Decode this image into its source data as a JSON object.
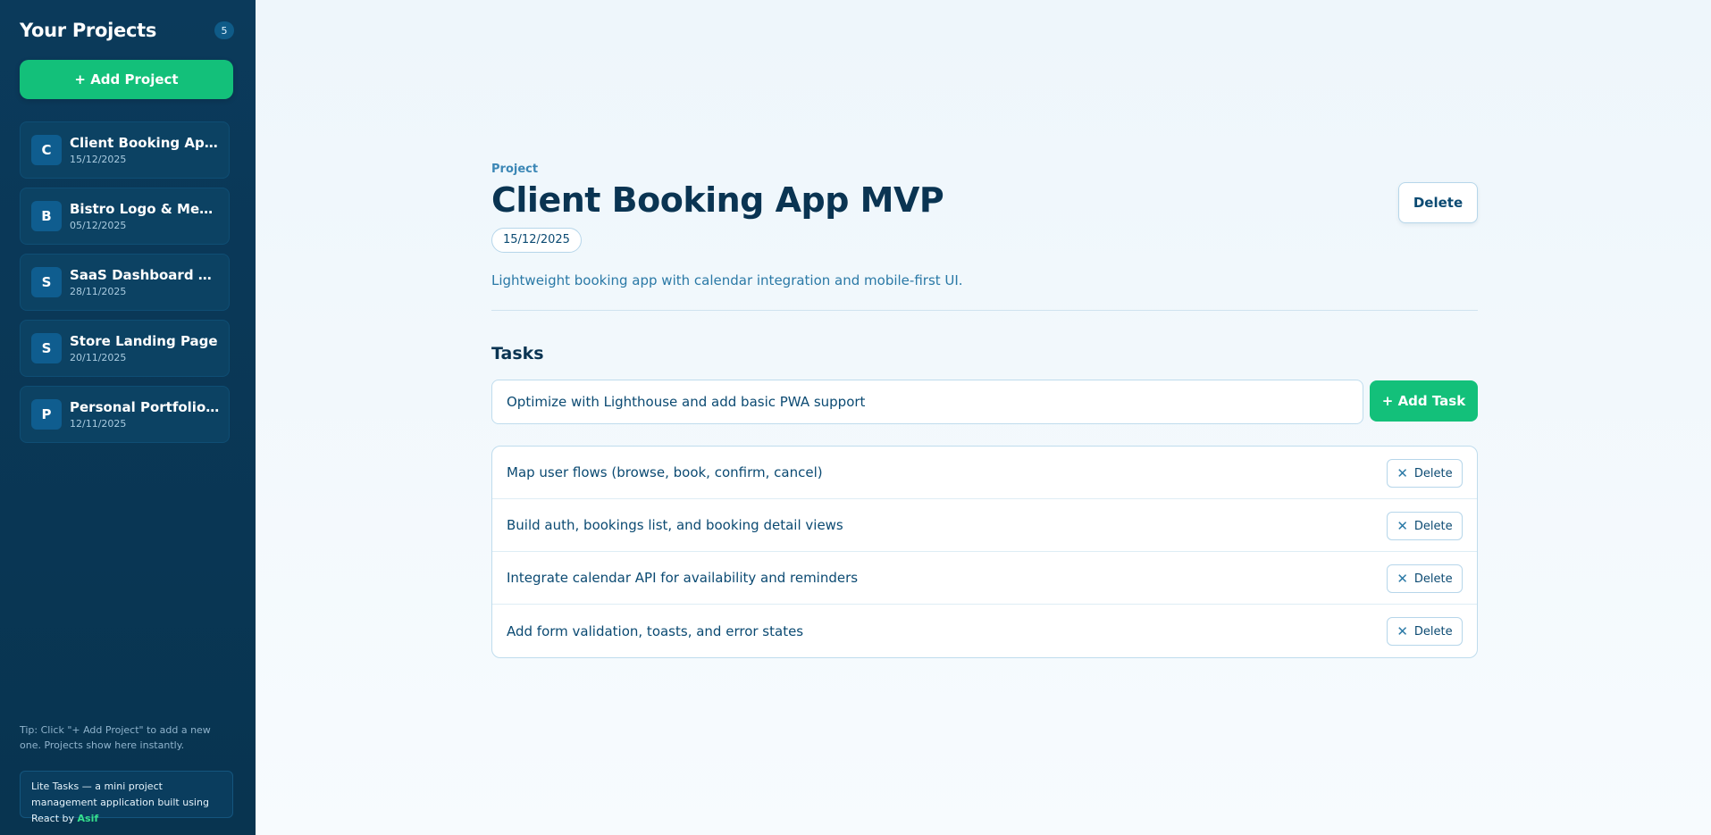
{
  "sidebar": {
    "title": "Your Projects",
    "count": "5",
    "add_project_label": "+ Add Project",
    "projects": [
      {
        "initial": "C",
        "name": "Client Booking App MVP",
        "date": "15/12/2025"
      },
      {
        "initial": "B",
        "name": "Bistro Logo & Menu Design",
        "date": "05/12/2025"
      },
      {
        "initial": "S",
        "name": "SaaS Dashboard UI Kit",
        "date": "28/11/2025"
      },
      {
        "initial": "S",
        "name": "Store Landing Page",
        "date": "20/11/2025"
      },
      {
        "initial": "P",
        "name": "Personal Portfolio Redesign",
        "date": "12/11/2025"
      }
    ],
    "tip": "Tip: Click \"+ Add Project\" to add a new one. Projects show here instantly.",
    "footer_text": "Lite Tasks — a mini project management application built using React by",
    "footer_author": "Asif"
  },
  "project": {
    "eyebrow": "Project",
    "title": "Client Booking App MVP",
    "delete_label": "Delete",
    "date": "15/12/2025",
    "description": "Lightweight booking app with calendar integration and mobile-first UI."
  },
  "tasks": {
    "heading": "Tasks",
    "input_value": "Optimize with Lighthouse and add basic PWA support",
    "add_label": "+ Add Task",
    "delete_label": "Delete",
    "items": [
      "Map user flows (browse, book, confirm, cancel)",
      "Build auth, bookings list, and booking detail views",
      "Integrate calendar API for availability and reminders",
      "Add form validation, toasts, and error states"
    ]
  },
  "colors": {
    "sidebar_bg": "#0b3a5b",
    "accent_green": "#13c07a",
    "text_primary": "#0a3452",
    "text_link": "#2a79a6"
  },
  "icons": {
    "task_delete": "close-icon"
  }
}
